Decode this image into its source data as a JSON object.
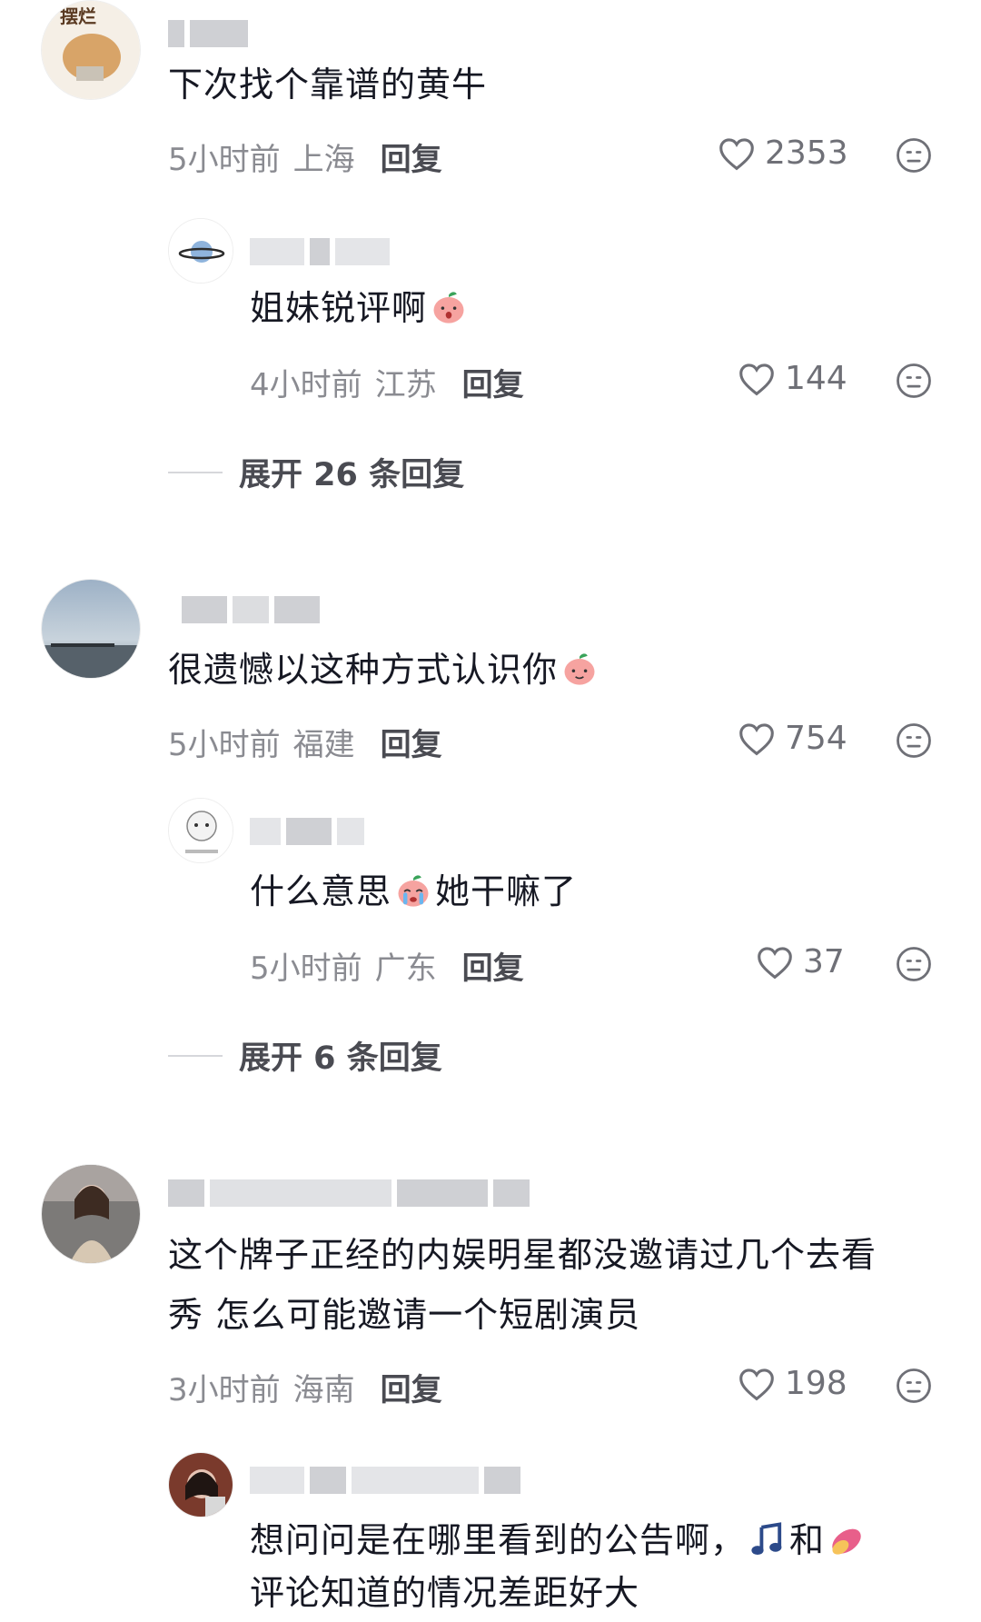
{
  "comments": [
    {
      "text": "下次找个靠谱的黄牛",
      "time": "5小时前",
      "region": "上海",
      "reply_label": "回复",
      "likes": "2353",
      "avatar_text": "摆烂"
    },
    {
      "text": "姐妹锐评啊",
      "time": "4小时前",
      "region": "江苏",
      "reply_label": "回复",
      "likes": "144"
    },
    {
      "text": "很遗憾以这种方式认识你",
      "time": "5小时前",
      "region": "福建",
      "reply_label": "回复",
      "likes": "754"
    },
    {
      "text_part1": "什么意思",
      "text_part2": "她干嘛了",
      "time": "5小时前",
      "region": "广东",
      "reply_label": "回复",
      "likes": "37"
    },
    {
      "text_line1": "这个牌子正经的内娱明星都没邀请过几个去看",
      "text_line2": "秀 怎么可能邀请一个短剧演员",
      "time": "3小时前",
      "region": "海南",
      "reply_label": "回复",
      "likes": "198"
    },
    {
      "text_line1a": "想问问是在哪里看到的公告啊，",
      "text_line1b": "和",
      "text_line2": "评论知道的情况差距好大"
    }
  ],
  "expand": [
    {
      "label": "展开 26 条回复"
    },
    {
      "label": "展开 6 条回复"
    }
  ],
  "colors": {
    "text": "#161823",
    "meta": "#8a8b91",
    "reply": "#4a4b52",
    "divider": "#d6d7db"
  }
}
